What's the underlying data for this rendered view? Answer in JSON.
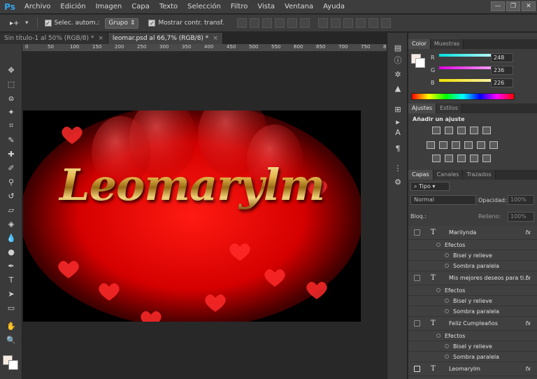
{
  "app": {
    "logo": "Ps"
  },
  "menu": [
    "Archivo",
    "Edición",
    "Imagen",
    "Capa",
    "Texto",
    "Selección",
    "Filtro",
    "Vista",
    "Ventana",
    "Ayuda"
  ],
  "window_controls": [
    "—",
    "❐",
    "✕"
  ],
  "options": {
    "tool_glyph": "▸+",
    "auto_select_label": "Selec. autom.:",
    "auto_select_value": "Grupo",
    "show_transform_label": "Mostrar contr. transf."
  },
  "tabs": [
    {
      "label": "Sin título-1 al 50% (RGB/8) *",
      "active": false
    },
    {
      "label": "leomar.psd al 66,7% (RGB/8) *",
      "active": true
    }
  ],
  "ruler": {
    "ticks": [
      "0",
      "50",
      "100",
      "150",
      "200",
      "250",
      "300",
      "350",
      "400",
      "450",
      "500",
      "550",
      "600",
      "650",
      "700",
      "750",
      "8"
    ]
  },
  "canvas": {
    "text": "Leomarylm"
  },
  "color_panel": {
    "tabs": [
      "Color",
      "Muestras"
    ],
    "channels": [
      {
        "label": "R",
        "value": "248",
        "color": "#00c4c8"
      },
      {
        "label": "G",
        "value": "236",
        "color": "#e040e0"
      },
      {
        "label": "B",
        "value": "226",
        "color": "#f0e000"
      }
    ],
    "fg_color": "#f8ece2"
  },
  "adjustments_panel": {
    "tabs": [
      "Ajustes",
      "Estilos"
    ],
    "title": "Añadir un ajuste"
  },
  "layers_panel": {
    "tabs": [
      "Capas",
      "Canales",
      "Trazados"
    ],
    "filter_label": "Tipo",
    "blend_mode": "Normal",
    "opacity_label": "Opacidad:",
    "opacity_value": "100%",
    "lock_label": "Bloq.:",
    "fill_label": "Relleno:",
    "fill_value": "100%",
    "layers": [
      {
        "name": "Marilynda",
        "effects": [
          "Efectos",
          "Bisel y relieve",
          "Sombra paralela"
        ]
      },
      {
        "name": "Mis mejores deseos  para ti.!",
        "effects": [
          "Efectos",
          "Bisel y relieve",
          "Sombra paralela"
        ]
      },
      {
        "name": "Feliz Cumpleaños",
        "effects": [
          "Efectos",
          "Bisel y relieve",
          "Sombra paralela"
        ]
      },
      {
        "name": "Leomarylm",
        "effects": []
      }
    ],
    "fx_label": "fx"
  }
}
